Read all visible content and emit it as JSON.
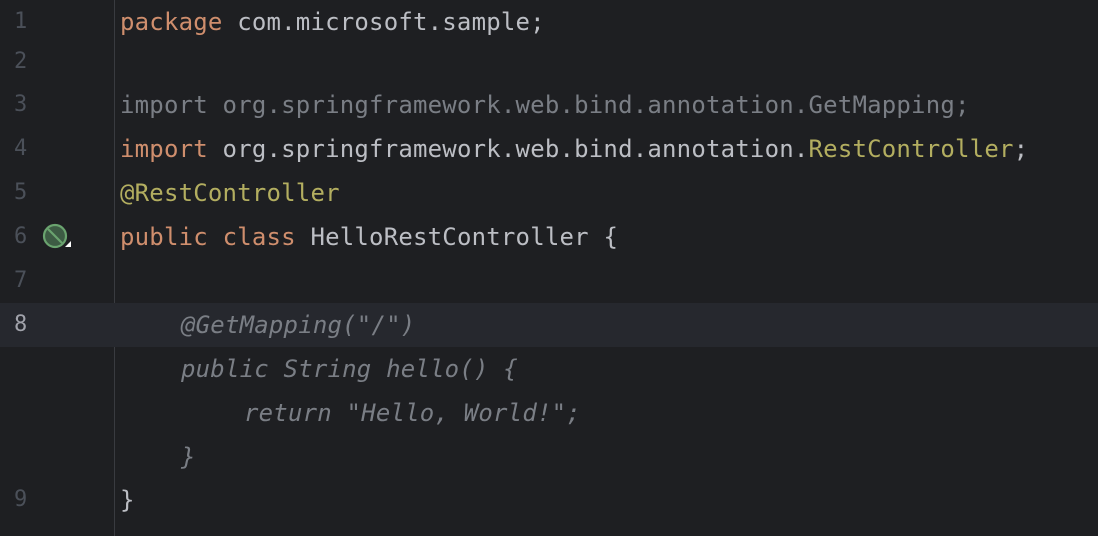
{
  "editor": {
    "lines": [
      {
        "number": "1",
        "parts": [
          "package",
          " com.microsoft.sample;"
        ]
      },
      {
        "number": "2"
      },
      {
        "number": "3",
        "parts": [
          "import org.springframework.web.bind.annotation.GetMapping;"
        ]
      },
      {
        "number": "4",
        "parts": [
          "import",
          " org.springframework.web.bind.annotation.",
          "RestController",
          ";"
        ]
      },
      {
        "number": "5",
        "parts": [
          "@RestController"
        ]
      },
      {
        "number": "6",
        "parts": [
          "public",
          " ",
          "class",
          " HelloRestController {"
        ],
        "gutter_icon": "spring-bean-icon"
      },
      {
        "number": "7"
      },
      {
        "number": "8",
        "parts": [
          "@GetMapping(\"/\")"
        ],
        "current": true
      },
      {
        "parts": [
          "public String hello() {"
        ]
      },
      {
        "parts": [
          "return \"Hello, World!\";"
        ]
      },
      {
        "parts": [
          "}"
        ]
      },
      {
        "number": "9",
        "parts": [
          "}"
        ]
      }
    ]
  },
  "colors": {
    "background": "#1e1f22",
    "keyword": "#cf8e6d",
    "annotation": "#b3ae60",
    "text": "#bcbec4",
    "comment_gray": "#7a7e85",
    "current_line": "#26282e"
  }
}
